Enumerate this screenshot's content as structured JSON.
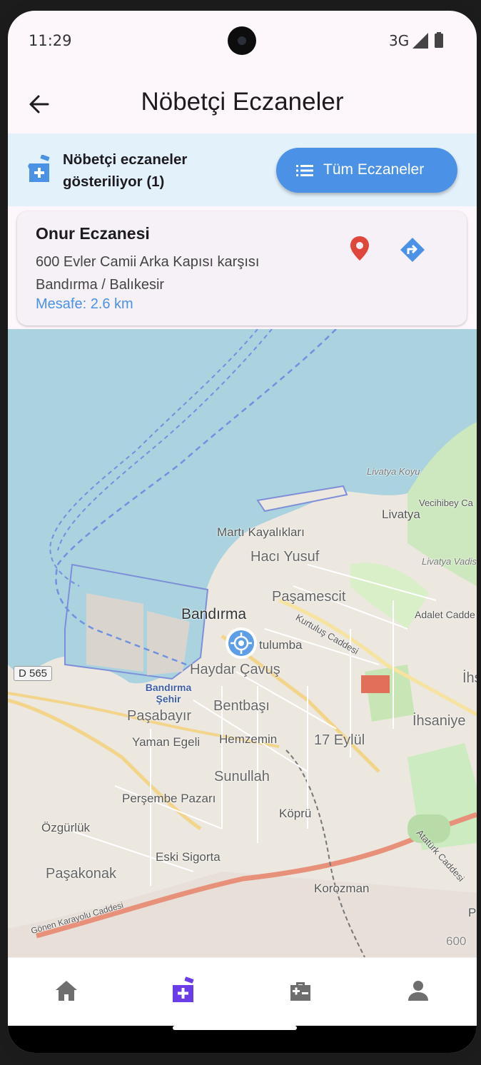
{
  "status_bar": {
    "time": "11:29",
    "network": "3G"
  },
  "app_bar": {
    "title": "Nöbetçi Eczaneler"
  },
  "banner": {
    "text": "Nöbetçi eczaneler gösteriliyor (1)",
    "button_label": "Tüm Eczaneler"
  },
  "pharmacy": {
    "name": "Onur Eczanesi",
    "address_line1": "600 Evler Camii Arka Kapısı karşısı",
    "address_line2": "Bandırma / Balıkesir",
    "distance": "Mesafe: 2.6 km"
  },
  "map": {
    "labels": {
      "livatya_koyu": "Livatya Koyu",
      "vecihibey": "Vecihibey Ca",
      "livatya": "Livatya",
      "marti": "Martı Kayalıkları",
      "haci_yusuf": "Hacı Yusuf",
      "livatya_vadisi": "Livatya Vadisi",
      "pasamescit": "Paşamescit",
      "adalet": "Adalet Cadde",
      "bandirma": "Bandırma",
      "tulumba": "tulumba",
      "kurtulus": "Kurtuluş Caddesi",
      "haydar": "Haydar Çavuş",
      "ihs": "İhs",
      "d565": "D 565",
      "bandirma_sehir": "Bandırma Şehir",
      "bentbasi": "Bentbaşı",
      "ihsaniye": "İhsaniye",
      "pasabayir": "Paşabayır",
      "yaman_egeli": "Yaman Egeli",
      "hemzemin": "Hemzemin",
      "onyedi_eylul": "17 Eylül",
      "sunullah": "Sunullah",
      "persembe": "Perşembe Pazarı",
      "kopru": "Köprü",
      "ozgurluk": "Özgürlük",
      "ataturk": "Atatürk Caddesi",
      "eski_sigorta": "Eski Sigorta",
      "pasakonak": "Paşakonak",
      "korozman": "Korozman",
      "gonen": "Gönen Karayolu Caddesi",
      "p": "P",
      "n600": "600"
    }
  },
  "nav": {
    "items": [
      "home-icon",
      "pharmacy-icon",
      "medical-kit-icon",
      "person-icon"
    ],
    "active_color": "#6a3de8"
  },
  "colors": {
    "accent": "#4b92e6",
    "banner_bg": "#e3f1fb",
    "pin": "#e0463a"
  }
}
